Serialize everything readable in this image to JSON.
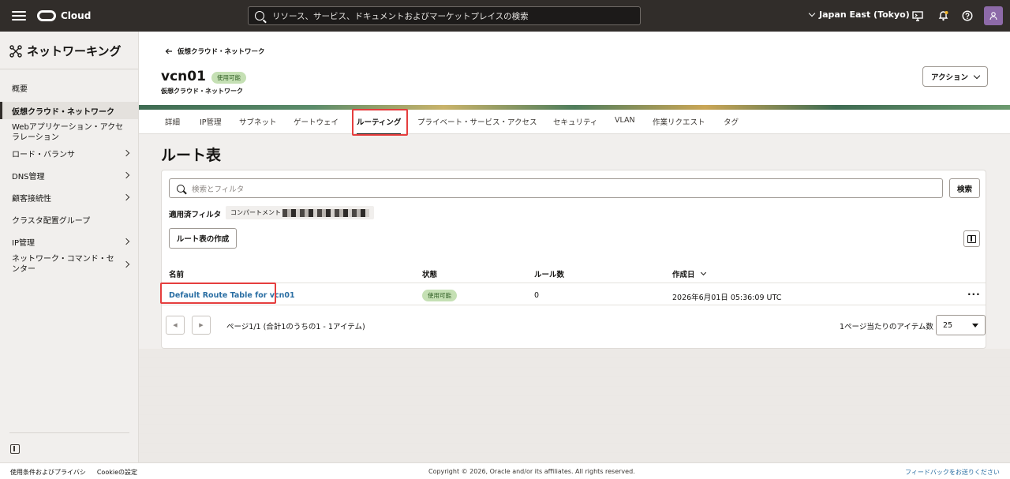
{
  "topbar": {
    "brand": "Cloud",
    "search_placeholder": "リソース、サービス、ドキュメントおよびマーケットプレイスの検索",
    "region": "Japan East (Tokyo)"
  },
  "sidebar": {
    "title": "ネットワーキング",
    "items": [
      {
        "label": "概要"
      },
      {
        "label": "仮想クラウド・ネットワーク"
      },
      {
        "label": "Webアプリケーション・アクセラレーション"
      },
      {
        "label": "ロード・バランサ"
      },
      {
        "label": "DNS管理"
      },
      {
        "label": "顧客接続性"
      },
      {
        "label": "クラスタ配置グループ"
      },
      {
        "label": "IP管理"
      },
      {
        "label": "ネットワーク・コマンド・センター"
      }
    ]
  },
  "header": {
    "back_label": "仮想クラウド・ネットワーク",
    "title": "vcn01",
    "status_badge": "使用可能",
    "subtitle": "仮想クラウド・ネットワーク",
    "action_label": "アクション"
  },
  "tabs": [
    {
      "label": "詳細"
    },
    {
      "label": "IP管理"
    },
    {
      "label": "サブネット"
    },
    {
      "label": "ゲートウェイ"
    },
    {
      "label": "ルーティング"
    },
    {
      "label": "プライベート・サービス・アクセス"
    },
    {
      "label": "セキュリティ"
    },
    {
      "label": "VLAN"
    },
    {
      "label": "作業リクエスト"
    },
    {
      "label": "タグ"
    }
  ],
  "main": {
    "heading": "ルート表",
    "filter_placeholder": "検索とフィルタ",
    "search_button": "検索",
    "applied_filter_label": "適用済フィルタ",
    "filter_chip_prefix": "コンパートメント",
    "create_button": "ルート表の作成",
    "columns": {
      "name": "名前",
      "state": "状態",
      "rule_count": "ルール数",
      "created": "作成日"
    },
    "rows": [
      {
        "name": "Default Route Table for vcn01",
        "state": "使用可能",
        "rule_count": "0",
        "created": "2026年6月01日 05:36:09 UTC"
      }
    ],
    "pager_text": "ページ1/1 (合計1のうちの1 - 1アイテム)",
    "per_page_label": "1ページ当たりのアイテム数",
    "per_page_value": "25"
  },
  "footer": {
    "terms": "使用条件およびプライバシ",
    "cookies": "Cookieの設定",
    "copyright": "Copyright © 2026, Oracle and/or its affiliates. All rights reserved.",
    "feedback": "フィードバックをお送りください"
  }
}
